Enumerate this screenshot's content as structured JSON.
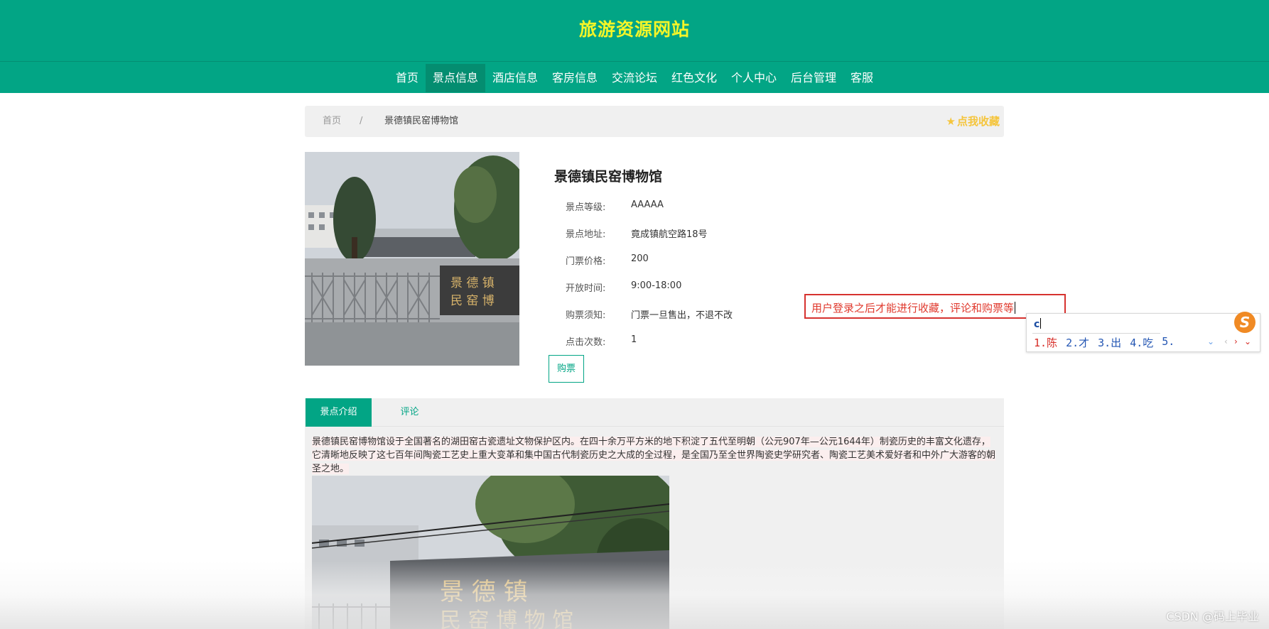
{
  "site": {
    "title": "旅游资源网站"
  },
  "nav": [
    {
      "label": "首页",
      "active": false
    },
    {
      "label": "景点信息",
      "active": true
    },
    {
      "label": "酒店信息",
      "active": false
    },
    {
      "label": "客房信息",
      "active": false
    },
    {
      "label": "交流论坛",
      "active": false
    },
    {
      "label": "红色文化",
      "active": false
    },
    {
      "label": "个人中心",
      "active": false
    },
    {
      "label": "后台管理",
      "active": false
    },
    {
      "label": "客服",
      "active": false
    }
  ],
  "breadcrumb": {
    "home": "首页",
    "separator": "/",
    "current": "景德镇民窑博物馆",
    "favorite": "点我收藏"
  },
  "detail": {
    "title": "景德镇民窑博物馆",
    "rows": [
      {
        "label": "景点等级:",
        "value": "AAAAA"
      },
      {
        "label": "景点地址:",
        "value": "竟成镇航空路18号"
      },
      {
        "label": "门票价格:",
        "value": "200"
      },
      {
        "label": "开放时间:",
        "value": "9:00-18:00"
      },
      {
        "label": "购票须知:",
        "value": "门票一旦售出，不退不改"
      },
      {
        "label": "点击次数:",
        "value": "1"
      }
    ],
    "buy_label": "购票"
  },
  "annotation": {
    "text": "用户登录之后才能进行收藏，评论和购票等"
  },
  "ime": {
    "input": "c",
    "candidates": [
      "1.陈",
      "2.才",
      "3.出",
      "4.吃",
      "5."
    ],
    "logo": "S"
  },
  "tabs": [
    {
      "label": "景点介绍",
      "active": true
    },
    {
      "label": "评论",
      "active": false
    }
  ],
  "intro": {
    "text": "景德镇民窑博物馆设于全国著名的湖田窑古瓷遗址文物保护区内。在四十余万平方米的地下积淀了五代至明朝（公元907年—公元1644年）制瓷历史的丰富文化遗存，它清晰地反映了这七百年间陶瓷工艺史上重大变革和集中国古代制瓷历史之大成的全过程，是全国乃至全世界陶瓷史学研究者、陶瓷工艺美术爱好者和中外广大游客的朝圣之地。"
  },
  "watermark": "CSDN @码上毕业",
  "colors": {
    "primary": "#02a585",
    "title_yellow": "#f5f528",
    "favorite": "#f5c53c",
    "annotation_red": "#d6322f"
  }
}
